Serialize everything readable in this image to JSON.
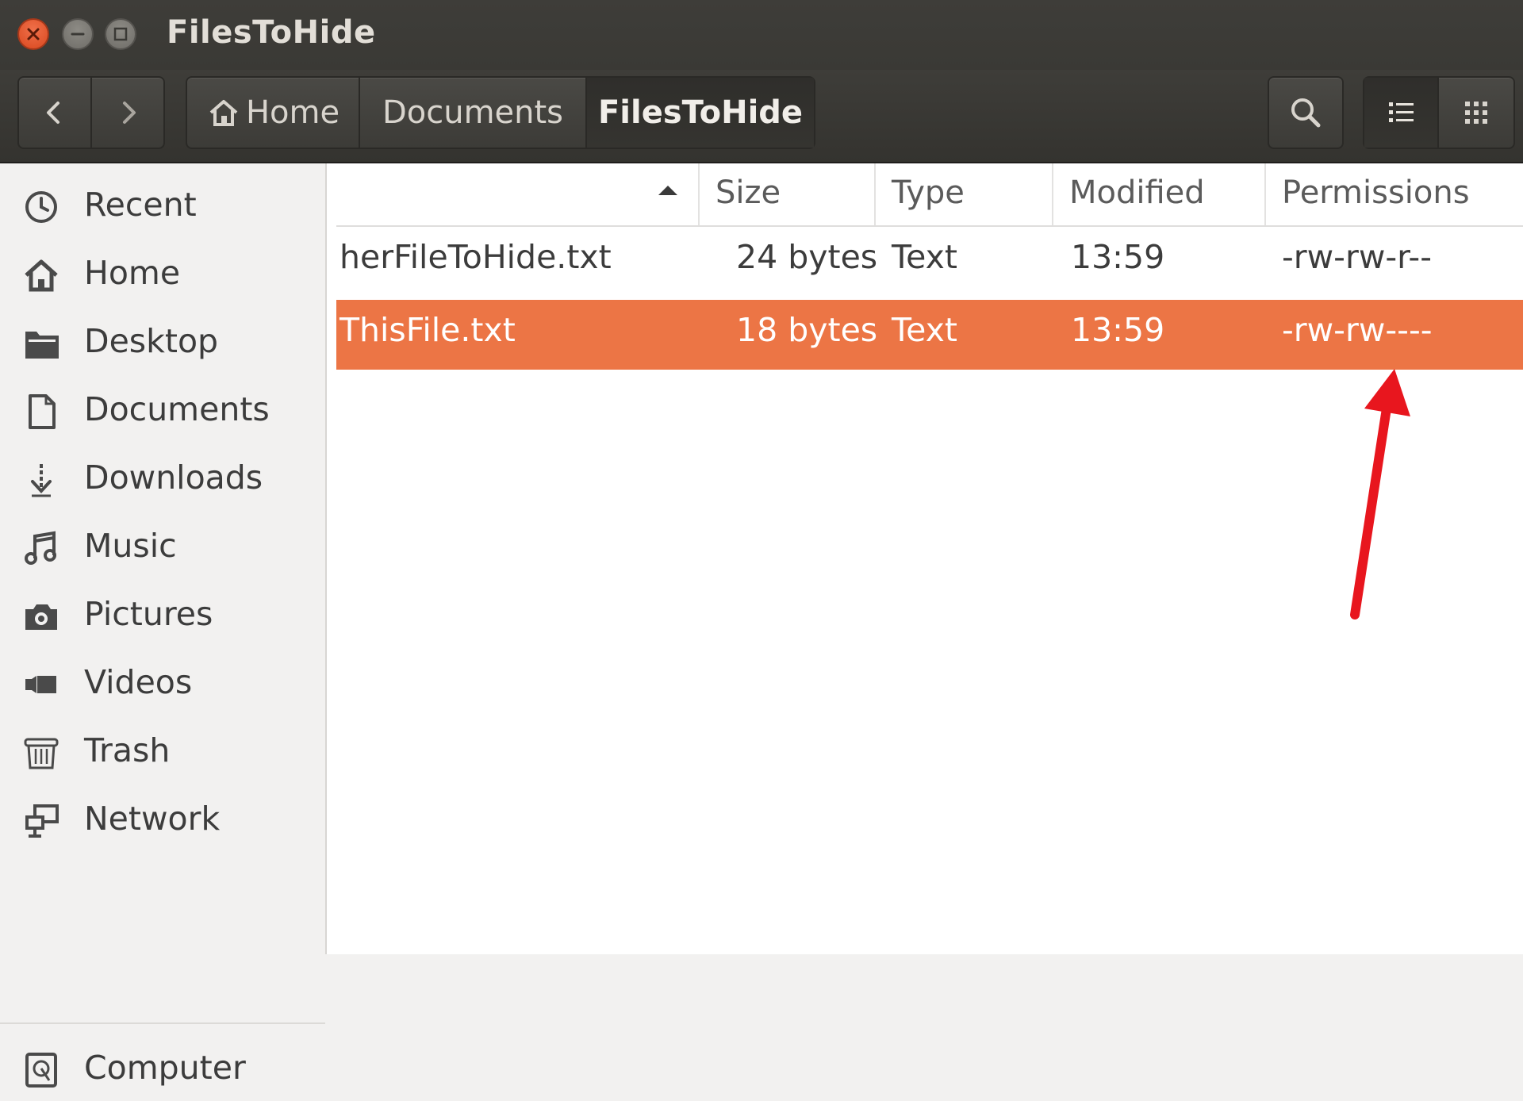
{
  "window": {
    "title": "FilesToHide"
  },
  "toolbar": {
    "breadcrumb": [
      "Home",
      "Documents",
      "FilesToHide"
    ],
    "active_crumb": "FilesToHide"
  },
  "sidebar": {
    "items": [
      {
        "label": "Recent",
        "icon": "clock-icon"
      },
      {
        "label": "Home",
        "icon": "home-icon"
      },
      {
        "label": "Desktop",
        "icon": "folder-icon"
      },
      {
        "label": "Documents",
        "icon": "document-icon"
      },
      {
        "label": "Downloads",
        "icon": "download-icon"
      },
      {
        "label": "Music",
        "icon": "music-icon"
      },
      {
        "label": "Pictures",
        "icon": "camera-icon"
      },
      {
        "label": "Videos",
        "icon": "video-icon"
      },
      {
        "label": "Trash",
        "icon": "trash-icon"
      },
      {
        "label": "Network",
        "icon": "network-icon"
      },
      {
        "label": "Computer",
        "icon": "computer-icon"
      }
    ]
  },
  "table": {
    "columns": [
      "",
      "Size",
      "Type",
      "Modified",
      "Permissions"
    ],
    "sort_indicator": "ascending",
    "rows": [
      {
        "name": "herFileToHide.txt",
        "size": "24 bytes",
        "type": "Text",
        "modified": "13:59",
        "permissions": "-rw-rw-r--",
        "selected": false
      },
      {
        "name": "ThisFile.txt",
        "size": "18 bytes",
        "type": "Text",
        "modified": "13:59",
        "permissions": "-rw-rw----",
        "selected": true
      }
    ]
  },
  "colors": {
    "selection": "#ec7545",
    "titlebar": "#3c3b37",
    "annotation_arrow": "#e8161e"
  }
}
